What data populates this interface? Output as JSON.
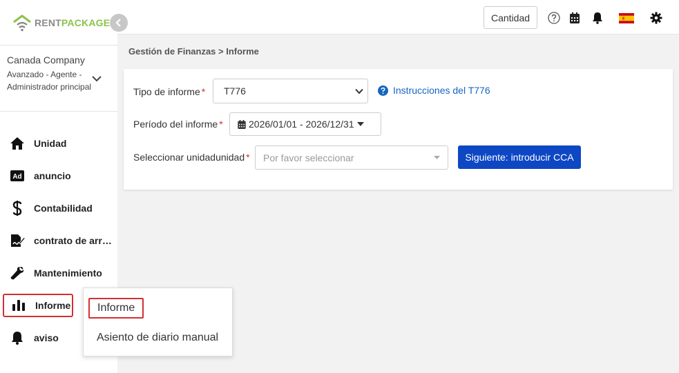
{
  "brand": {
    "logo_rent": "RENT",
    "logo_package": "PACKAGE",
    "accent": "#8bc34a"
  },
  "company": {
    "name": "Canada Company",
    "role": "Avanzado - Agente - Administrador principal"
  },
  "sidebar": {
    "items": [
      {
        "label": "Unidad",
        "icon": "home-icon"
      },
      {
        "label": "anuncio",
        "icon": "ad-icon"
      },
      {
        "label": "Contabilidad",
        "icon": "dollar-icon"
      },
      {
        "label": "contrato de arre...",
        "icon": "signature-icon"
      },
      {
        "label": "Mantenimiento",
        "icon": "wrench-icon"
      },
      {
        "label": "Informe",
        "icon": "bar-chart-icon"
      },
      {
        "label": "aviso",
        "icon": "bell-icon"
      }
    ]
  },
  "popup": {
    "items": [
      {
        "label": "Informe"
      },
      {
        "label": "Asiento de diario manual"
      }
    ]
  },
  "header": {
    "cantidad_label": "Cantidad",
    "icons": [
      "help-circle-icon",
      "calendar-icon",
      "bell-icon",
      "spain-flag-icon",
      "gear-icon"
    ]
  },
  "breadcrumb": "Gestión de Finanzas > Informe",
  "form": {
    "report_type": {
      "label": "Tipo de informe",
      "value": "T776"
    },
    "help_link": "Instrucciones del T776",
    "period": {
      "label": "Período del informe",
      "value": "2026/01/01 - 2026/12/31"
    },
    "unit": {
      "label": "Seleccionar unidadunidad",
      "placeholder": "Por favor seleccionar"
    },
    "required_mark": "*",
    "next_button": "Siguiente: introducir CCA"
  },
  "colors": {
    "primary": "#0d47c4",
    "link": "#1565c0",
    "required": "#d32f2f",
    "highlight_border": "#d32f2f"
  }
}
